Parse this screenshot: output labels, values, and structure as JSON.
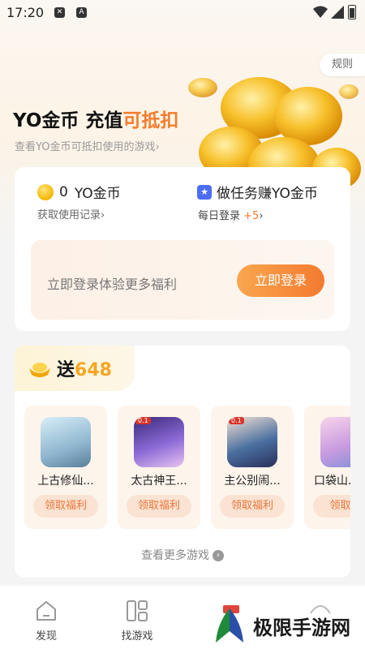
{
  "status_bar": {
    "time": "17:20"
  },
  "rules_label": "规则",
  "hero": {
    "title_main": "YO金币 充值",
    "title_highlight": "可抵扣",
    "subtitle": "查看YO金币可抵扣使用的游戏"
  },
  "coins_card": {
    "balance_value": "0",
    "balance_unit": "YO金币",
    "record_link": "获取使用记录",
    "task_title": "做任务赚YO金币",
    "daily_login_label": "每日登录",
    "daily_login_reward": "+5",
    "login_prompt": "立即登录体验更多福利",
    "login_button": "立即登录"
  },
  "games_card": {
    "gift_label": "送",
    "gift_amount": "648",
    "games": [
      {
        "name": "上古修仙...",
        "claim": "领取福利"
      },
      {
        "name": "太古神王...",
        "claim": "领取福利"
      },
      {
        "name": "主公别闹...",
        "claim": "领取福利"
      },
      {
        "name": "口袋山...",
        "claim": "领取福"
      }
    ],
    "more_games": "查看更多游戏"
  },
  "tab_bar": {
    "tabs": [
      {
        "label": "发现",
        "icon": "home-icon"
      },
      {
        "label": "找游戏",
        "icon": "grid-icon"
      },
      {
        "label": "",
        "icon": "gift-icon"
      },
      {
        "label": "",
        "icon": "profile-icon"
      }
    ]
  },
  "watermark": "极限手游网",
  "colors": {
    "accent": "#f57c2c",
    "gold": "#f5a623",
    "task_blue": "#4c6ef5"
  }
}
